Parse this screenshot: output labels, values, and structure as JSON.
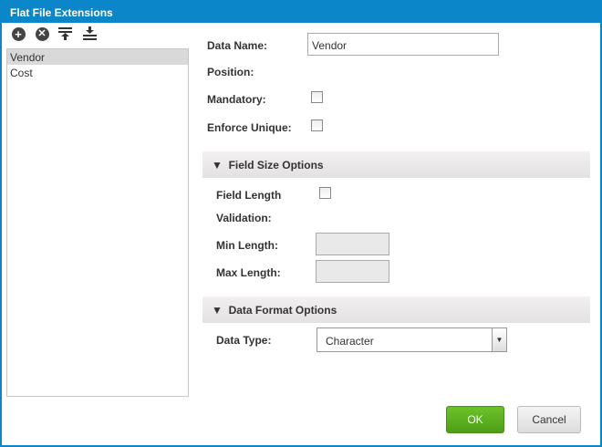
{
  "window": {
    "title": "Flat File Extensions"
  },
  "toolbar": [
    "add-icon",
    "remove-icon",
    "move-top-icon",
    "move-bottom-icon"
  ],
  "fields": [
    {
      "label": "Vendor",
      "selected": true
    },
    {
      "label": "Cost",
      "selected": false
    }
  ],
  "form": {
    "data_name_label": "Data Name:",
    "data_name_value": "Vendor",
    "position_label": "Position:",
    "mandatory_label": "Mandatory:",
    "enforce_unique_label": "Enforce Unique:",
    "field_size_section": "Field Size Options",
    "field_length_label": "Field Length",
    "validation_label": "Validation:",
    "min_length_label": "Min Length:",
    "max_length_label": "Max Length:",
    "data_format_section": "Data Format Options",
    "data_type_label": "Data Type:",
    "data_type_value": "Character"
  },
  "buttons": {
    "ok": "OK",
    "cancel": "Cancel"
  },
  "colors": {
    "accent": "#0b86c8",
    "ok": "#5aad1e"
  }
}
